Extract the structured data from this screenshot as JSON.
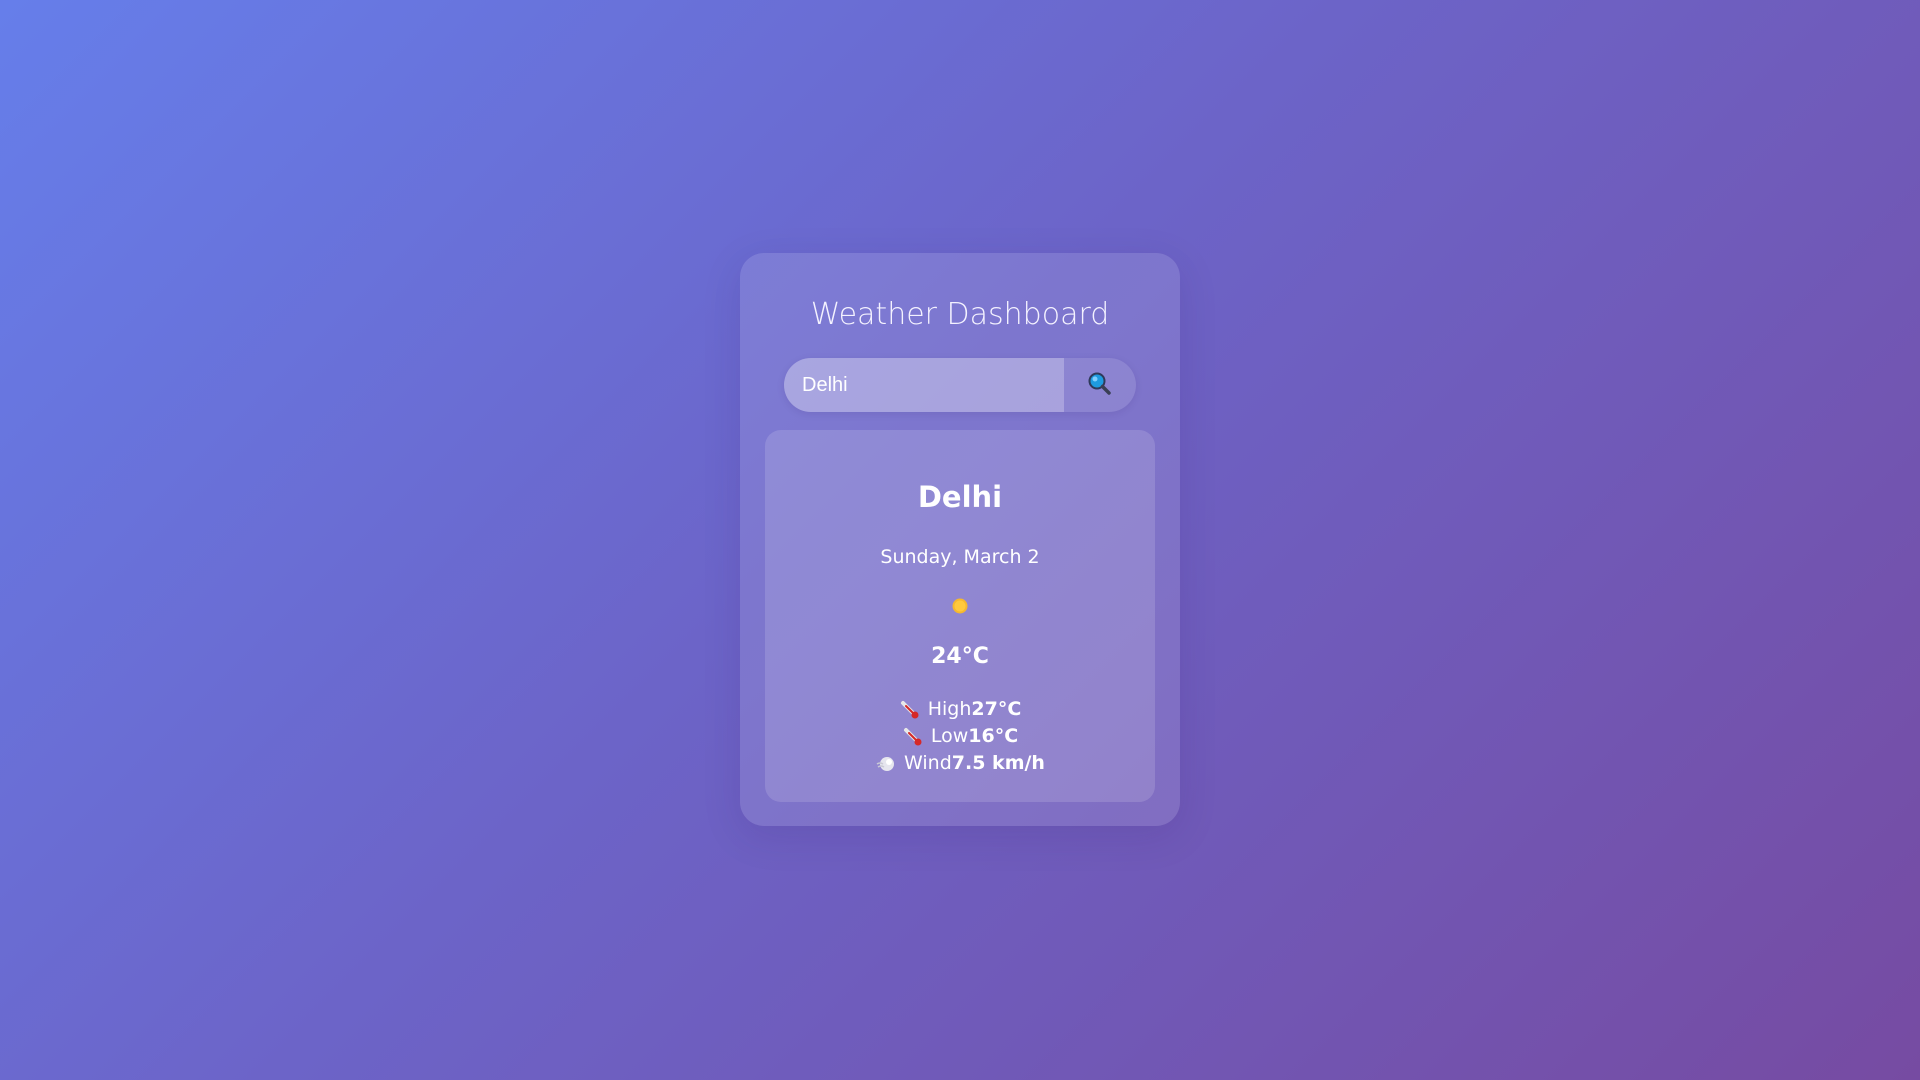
{
  "app": {
    "title": "Weather Dashboard"
  },
  "search": {
    "value": "Delhi",
    "icon": "search-icon"
  },
  "weather": {
    "city": "Delhi",
    "date": "Sunday, March 2",
    "condition_icon": "sun-icon",
    "temperature": "24°C",
    "details": [
      {
        "icon": "thermometer-icon",
        "label": "High",
        "value": "27°C"
      },
      {
        "icon": "thermometer-icon",
        "label": "Low",
        "value": "16°C"
      },
      {
        "icon": "wind-icon",
        "label": "Wind",
        "value": "7.5 km/h"
      }
    ]
  },
  "colors": {
    "background_start": "#667eea",
    "background_end": "#764ba2",
    "sun": "#f5b82e",
    "thermometer": "#d62828",
    "search_icon": "#1e9be0"
  }
}
